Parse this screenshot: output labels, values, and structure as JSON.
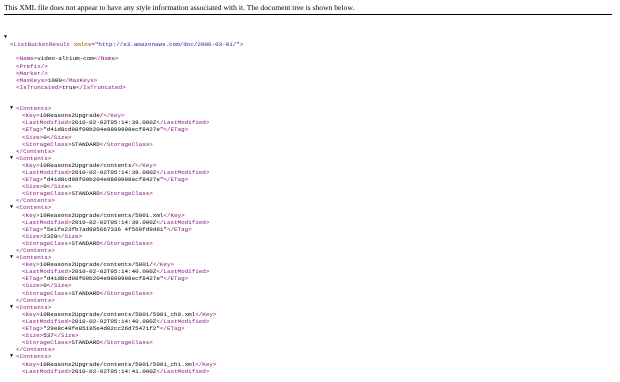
{
  "header": {
    "message": "This XML file does not appear to have any style information associated with it. The document tree is shown below."
  },
  "root": {
    "open": "<ListBucketResult",
    "attr_name": "xmlns",
    "attr_eq": "=",
    "attr_value": "\"http://s3.amazonaws.com/doc/2006-03-01/\"",
    "open_end": ">",
    "toggle": "▼"
  },
  "top_fields": [
    {
      "o": "<Name>",
      "v": "video-altium-com",
      "c": "</Name>"
    },
    {
      "o": "<Prefix/>",
      "v": "",
      "c": ""
    },
    {
      "o": "<Marker/>",
      "v": "",
      "c": ""
    },
    {
      "o": "<MaxKeys>",
      "v": "1000",
      "c": "</MaxKeys>"
    },
    {
      "o": "<IsTruncated>",
      "v": "true",
      "c": "</IsTruncated>"
    }
  ],
  "contents": [
    {
      "open": "<Contents>",
      "close": "</Contents>",
      "toggle": "▼",
      "fields": [
        {
          "o": "<Key>",
          "v": "10Reasons2Upgrade/",
          "c": "</Key>"
        },
        {
          "o": "<LastModified>",
          "v": "2010-02-02T05:14:39.000Z",
          "c": "</LastModified>"
        },
        {
          "o": "<ETag>",
          "v": "\"d41d8cd98f00b204e9800998ecf8427e\"",
          "c": "</ETag>"
        },
        {
          "o": "<Size>",
          "v": "0",
          "c": "</Size>"
        },
        {
          "o": "<StorageClass>",
          "v": "STANDARD",
          "c": "</StorageClass>"
        }
      ]
    },
    {
      "open": "<Contents>",
      "close": "</Contents>",
      "toggle": "▼",
      "fields": [
        {
          "o": "<Key>",
          "v": "10Reasons2Upgrade/contents/",
          "c": "</Key>"
        },
        {
          "o": "<LastModified>",
          "v": "2010-02-02T05:14:39.000Z",
          "c": "</LastModified>"
        },
        {
          "o": "<ETag>",
          "v": "\"d41d8cd98f00b204e9800998ecf8427e\"",
          "c": "</ETag>"
        },
        {
          "o": "<Size>",
          "v": "0",
          "c": "</Size>"
        },
        {
          "o": "<StorageClass>",
          "v": "STANDARD",
          "c": "</StorageClass>"
        }
      ]
    },
    {
      "open": "<Contents>",
      "close": "</Contents>",
      "toggle": "▼",
      "fields": [
        {
          "o": "<Key>",
          "v": "10Reasons2Upgrade/contents/5001.xml",
          "c": "</Key>"
        },
        {
          "o": "<LastModified>",
          "v": "2010-02-02T05:14:39.000Z",
          "c": "</LastModified>"
        },
        {
          "o": "<ETag>",
          "v": "\"5e1fe23fb7ad985667336 4f569fd9d81\"",
          "c": "</ETag>"
        },
        {
          "o": "<Size>",
          "v": "2328",
          "c": "</Size>"
        },
        {
          "o": "<StorageClass>",
          "v": "STANDARD",
          "c": "</StorageClass>"
        }
      ]
    },
    {
      "open": "<Contents>",
      "close": "</Contents>",
      "toggle": "▼",
      "fields": [
        {
          "o": "<Key>",
          "v": "10Reasons2Upgrade/contents/5001/",
          "c": "</Key>"
        },
        {
          "o": "<LastModified>",
          "v": "2010-02-02T05:14:40.000Z",
          "c": "</LastModified>"
        },
        {
          "o": "<ETag>",
          "v": "\"d41d8cd98f00b204e9800998ecf8427e\"",
          "c": "</ETag>"
        },
        {
          "o": "<Size>",
          "v": "0",
          "c": "</Size>"
        },
        {
          "o": "<StorageClass>",
          "v": "STANDARD",
          "c": "</StorageClass>"
        }
      ]
    },
    {
      "open": "<Contents>",
      "close": "</Contents>",
      "toggle": "▼",
      "fields": [
        {
          "o": "<Key>",
          "v": "10Reasons2Upgrade/contents/5001/5001_ch0.xml",
          "c": "</Key>"
        },
        {
          "o": "<LastModified>",
          "v": "2010-02-02T05:14:40.000Z",
          "c": "</LastModified>"
        },
        {
          "o": "<ETag>",
          "v": "\"29e8c49fe85195e4d02cc26d75471f2\"",
          "c": "</ETag>"
        },
        {
          "o": "<Size>",
          "v": "537",
          "c": "</Size>"
        },
        {
          "o": "<StorageClass>",
          "v": "STANDARD",
          "c": "</StorageClass>"
        }
      ]
    },
    {
      "open": "<Contents>",
      "close": "",
      "toggle": "▼",
      "fields": [
        {
          "o": "<Key>",
          "v": "10Reasons2Upgrade/contents/5001/5001_ch1.xml",
          "c": "</Key>"
        },
        {
          "o": "<LastModified>",
          "v": "2010-02-02T05:14:41.000Z",
          "c": "</LastModified>"
        }
      ]
    }
  ]
}
